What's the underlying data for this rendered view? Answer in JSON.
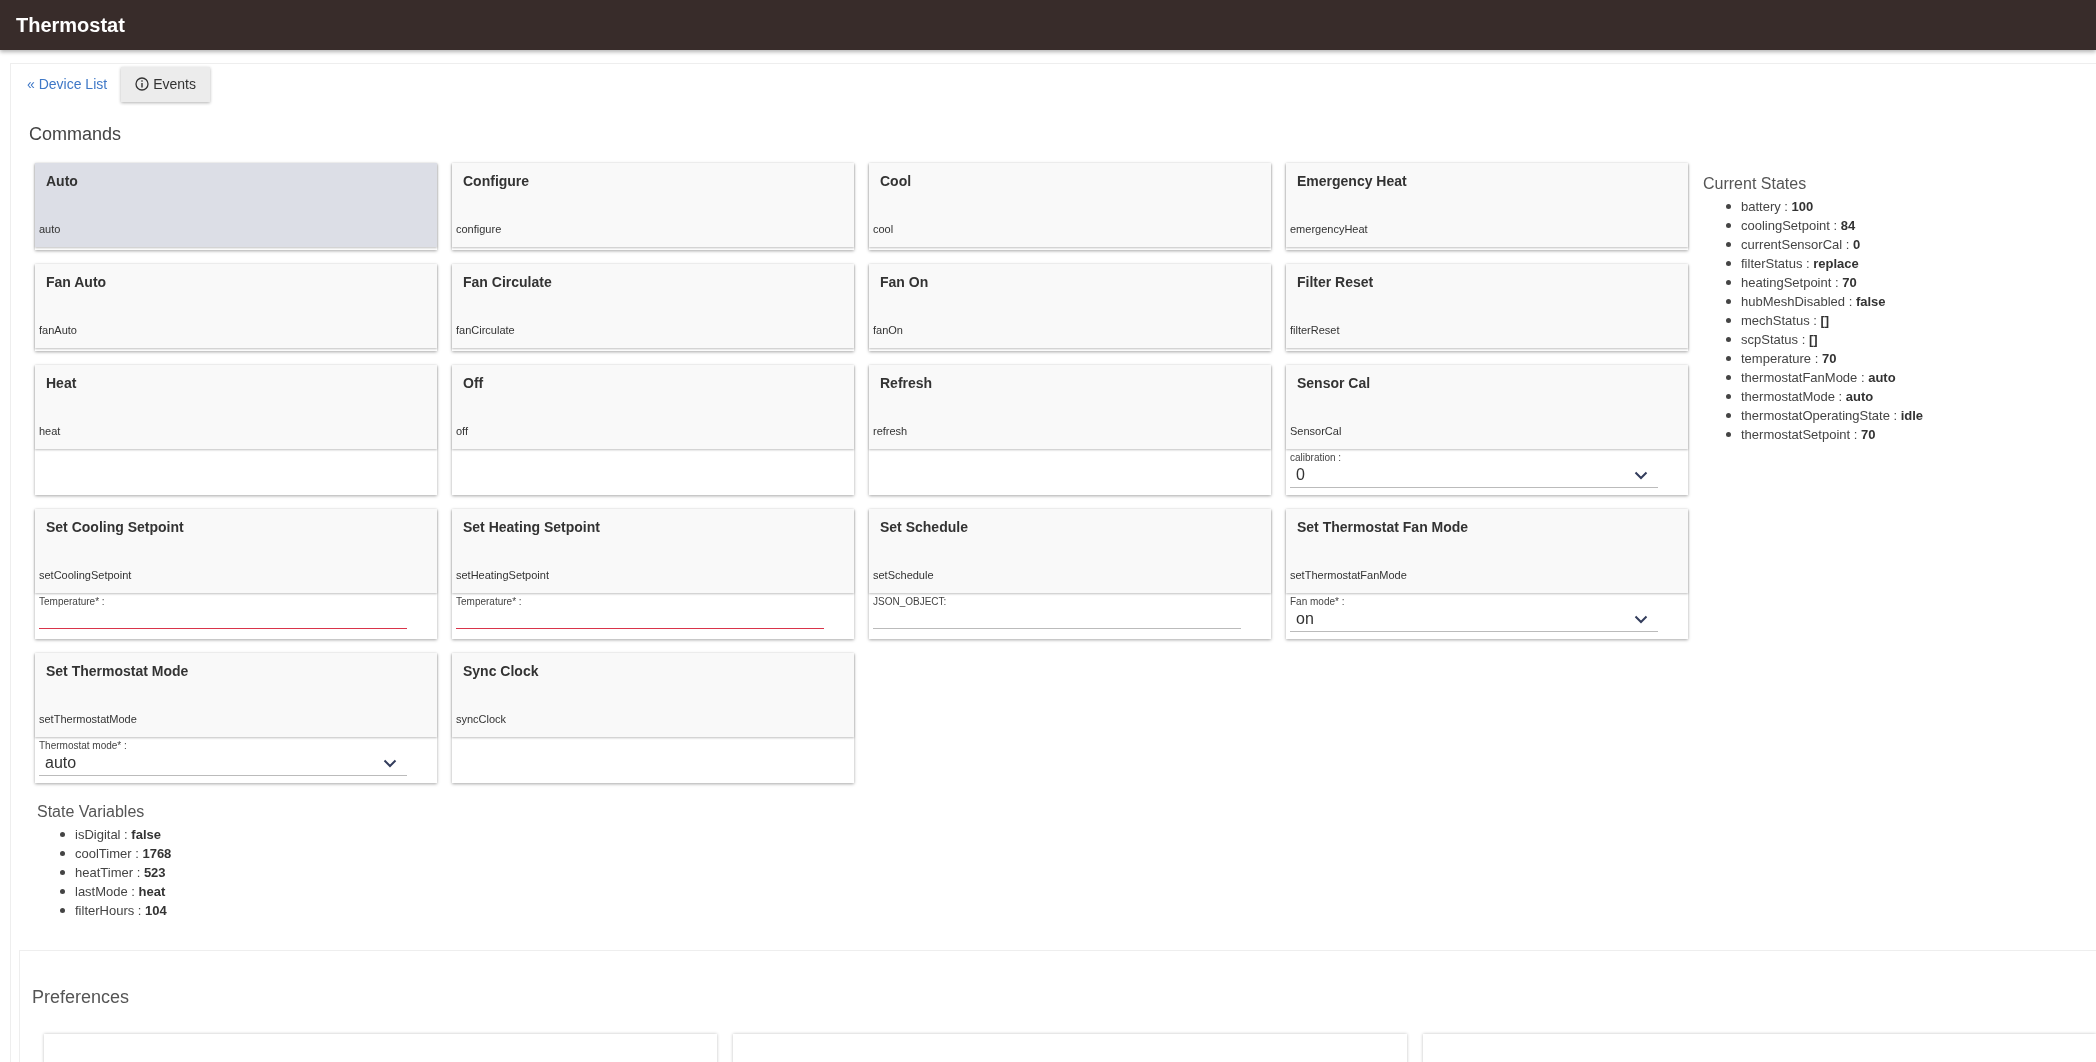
{
  "header": {
    "title": "Thermostat"
  },
  "nav": {
    "back_link": "« Device List",
    "events_button": "Events"
  },
  "commands": {
    "title": "Commands",
    "items": [
      {
        "label": "Auto",
        "command": "auto",
        "selected": true
      },
      {
        "label": "Configure",
        "command": "configure",
        "selected": false
      },
      {
        "label": "Cool",
        "command": "cool",
        "selected": false
      },
      {
        "label": "Emergency Heat",
        "command": "emergencyHeat",
        "selected": false
      },
      {
        "label": "Fan Auto",
        "command": "fanAuto",
        "selected": false
      },
      {
        "label": "Fan Circulate",
        "command": "fanCirculate",
        "selected": false
      },
      {
        "label": "Fan On",
        "command": "fanOn",
        "selected": false
      },
      {
        "label": "Filter Reset",
        "command": "filterReset",
        "selected": false
      },
      {
        "label": "Heat",
        "command": "heat",
        "selected": false
      },
      {
        "label": "Off",
        "command": "off",
        "selected": false
      },
      {
        "label": "Refresh",
        "command": "refresh",
        "selected": false
      },
      {
        "label": "Sensor Cal",
        "command": "SensorCal",
        "selected": false,
        "param": {
          "kind": "select",
          "label": "calibration :",
          "value": "0"
        }
      },
      {
        "label": "Set Cooling Setpoint",
        "command": "setCoolingSetpoint",
        "selected": false,
        "param": {
          "kind": "text",
          "label": "Temperature* :",
          "invalid": true
        }
      },
      {
        "label": "Set Heating Setpoint",
        "command": "setHeatingSetpoint",
        "selected": false,
        "param": {
          "kind": "text",
          "label": "Temperature* :",
          "invalid": true
        }
      },
      {
        "label": "Set Schedule",
        "command": "setSchedule",
        "selected": false,
        "param": {
          "kind": "text",
          "label": "JSON_OBJECT:",
          "invalid": false
        }
      },
      {
        "label": "Set Thermostat Fan Mode",
        "command": "setThermostatFanMode",
        "selected": false,
        "param": {
          "kind": "select",
          "label": "Fan mode* :",
          "value": "on"
        }
      },
      {
        "label": "Set Thermostat Mode",
        "command": "setThermostatMode",
        "selected": false,
        "param": {
          "kind": "select",
          "label": "Thermostat mode* :",
          "value": "auto"
        }
      },
      {
        "label": "Sync Clock",
        "command": "syncClock",
        "selected": false
      }
    ]
  },
  "current_states": {
    "title": "Current States",
    "items": [
      "battery : **100**",
      "coolingSetpoint : **84**",
      "currentSensorCal : **0**",
      "filterStatus : **replace**",
      "heatingSetpoint : **70**",
      "hubMeshDisabled : **false**",
      "mechStatus : **[]**",
      "scpStatus : **[]**",
      "temperature : **70**",
      "thermostatFanMode : **auto**",
      "thermostatMode : **auto**",
      "thermostatOperatingState : **idle**",
      "thermostatSetpoint : **70**"
    ]
  },
  "state_variables": {
    "title": "State Variables",
    "items": [
      "isDigital : **false**",
      "coolTimer : **1768**",
      "heatTimer : **523**",
      "lastMode : **heat**",
      "filterHours : **104**"
    ]
  },
  "preferences": {
    "title": "Preferences"
  }
}
